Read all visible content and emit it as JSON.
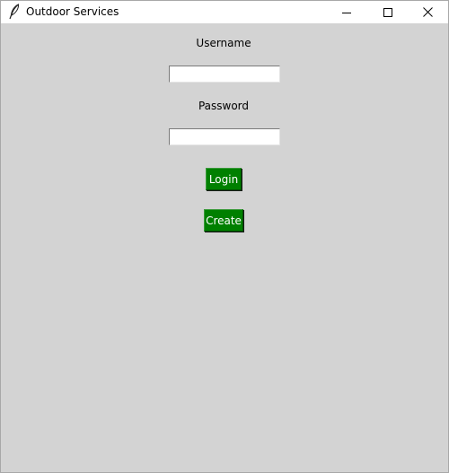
{
  "window": {
    "title": "Outdoor Services",
    "controls": [
      "minimize-icon",
      "maximize-icon",
      "close-icon"
    ]
  },
  "form": {
    "username_label": "Username",
    "username_value": "",
    "password_label": "Password",
    "password_value": "",
    "login_label": "Login",
    "create_label": "Create"
  },
  "colors": {
    "background": "#d3d3d3",
    "button": "#008000",
    "button_text": "#ffffff"
  }
}
